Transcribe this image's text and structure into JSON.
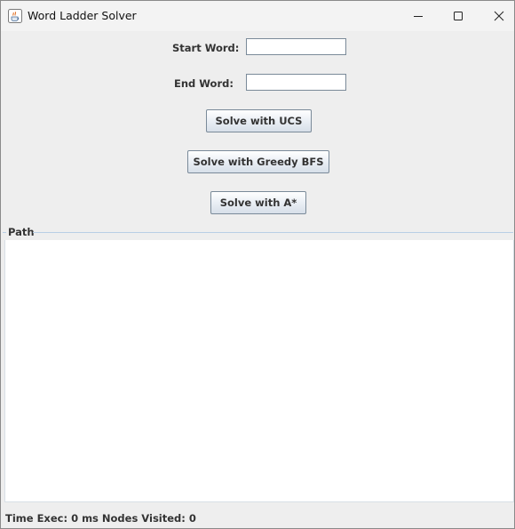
{
  "window": {
    "title": "Word Ladder Solver",
    "icon": "java-cup-icon"
  },
  "controls": {
    "minimize_icon": "minimize-icon",
    "maximize_icon": "maximize-icon",
    "close_icon": "close-icon"
  },
  "form": {
    "start_label": "Start Word:",
    "start_value": "",
    "end_label": "End Word:",
    "end_value": ""
  },
  "buttons": {
    "ucs": "Solve with UCS",
    "greedy": "Solve with Greedy BFS",
    "astar": "Solve with A*"
  },
  "path": {
    "legend": "Path",
    "content": ""
  },
  "status": {
    "text": "Time Exec: 0 ms  Nodes Visited: 0"
  },
  "colors": {
    "window_bg": "#eeeeee",
    "button_gradient_bottom": "#d7dfe9",
    "group_border": "#b8cfe5"
  }
}
